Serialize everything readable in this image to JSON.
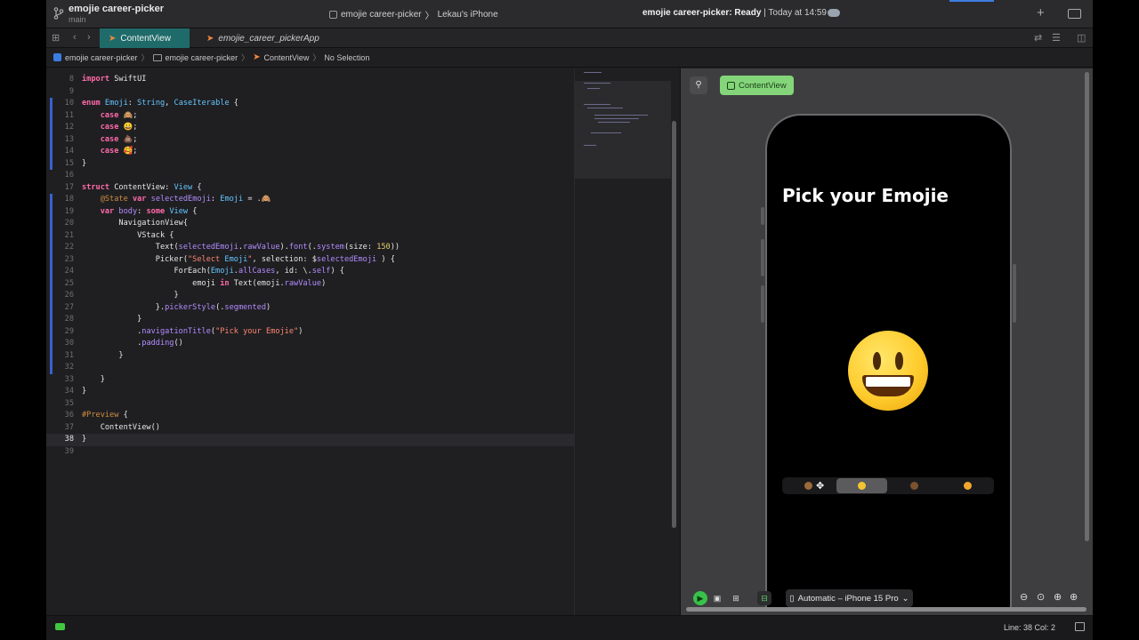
{
  "window": {
    "app_title": "emojie career-picker",
    "branch": "main",
    "scheme": "emojie career-picker",
    "device": "Lekau's iPhone",
    "status_bold": "emojie career-picker: Ready",
    "status_rest": " | Today at 14:59"
  },
  "tabs": [
    {
      "label": "ContentView",
      "active": true
    },
    {
      "label": "emojie_career_pickerApp",
      "active": false
    }
  ],
  "jumpbar": {
    "project": "emojie career-picker",
    "group": "emojie career-picker",
    "file": "ContentView",
    "selection": "No Selection"
  },
  "code": {
    "current_line": "38",
    "lines": [
      {
        "n": "8",
        "text": "import SwiftUI"
      },
      {
        "n": "9",
        "text": ""
      },
      {
        "n": "10",
        "text": "enum Emoji: String, CaseIterable {"
      },
      {
        "n": "11",
        "text": "    case 🙈;"
      },
      {
        "n": "12",
        "text": "    case 😀;"
      },
      {
        "n": "13",
        "text": "    case 💩;"
      },
      {
        "n": "14",
        "text": "    case 🥰;"
      },
      {
        "n": "15",
        "text": "}"
      },
      {
        "n": "16",
        "text": ""
      },
      {
        "n": "17",
        "text": "struct ContentView: View {"
      },
      {
        "n": "18",
        "text": "    @State var selectedEmoji: Emoji = .🙈"
      },
      {
        "n": "19",
        "text": "    var body: some View {"
      },
      {
        "n": "20",
        "text": "        NavigationView{"
      },
      {
        "n": "21",
        "text": "            VStack {"
      },
      {
        "n": "22",
        "text": "                Text(selectedEmoji.rawValue).font(.system(size: 150))"
      },
      {
        "n": "23",
        "text": "                Picker(\"Select Emoji\", selection: $selectedEmoji ) {"
      },
      {
        "n": "24",
        "text": "                    ForEach(Emoji.allCases, id: \\.self) {"
      },
      {
        "n": "25",
        "text": "                        emoji in Text(emoji.rawValue)"
      },
      {
        "n": "26",
        "text": "                    }"
      },
      {
        "n": "27",
        "text": "                }.pickerStyle(.segmented)"
      },
      {
        "n": "28",
        "text": "            }"
      },
      {
        "n": "29",
        "text": "            .navigationTitle(\"Pick your Emojie\")"
      },
      {
        "n": "30",
        "text": "            .padding()"
      },
      {
        "n": "31",
        "text": "        }"
      },
      {
        "n": "32",
        "text": ""
      },
      {
        "n": "33",
        "text": "    }"
      },
      {
        "n": "34",
        "text": "}"
      },
      {
        "n": "35",
        "text": ""
      },
      {
        "n": "36",
        "text": "#Preview {"
      },
      {
        "n": "37",
        "text": "    ContentView()"
      },
      {
        "n": "38",
        "text": "}"
      },
      {
        "n": "39",
        "text": ""
      }
    ]
  },
  "preview": {
    "chip_label": "ContentView",
    "nav_title": "Pick your Emojie",
    "selected_segment": 1,
    "device_label": "Automatic – iPhone 15 Pro"
  },
  "statusbar": {
    "position": "Line: 38  Col: 2"
  },
  "colors": {
    "active_tab": "#1e6b6a",
    "preview_chip": "#84d57a",
    "accent_blue": "#3d7de0"
  }
}
